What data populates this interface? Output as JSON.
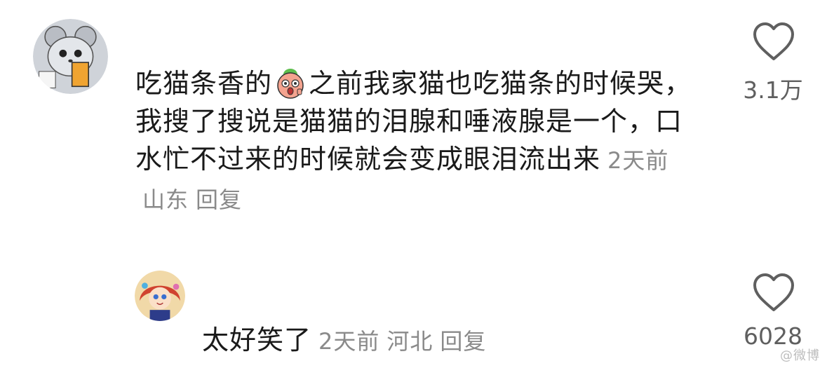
{
  "comments": [
    {
      "text_before_emoji": "吃猫条香的",
      "emoji": "peach-face-emoji",
      "text_after_emoji": "之前我家猫也吃猫条的时候哭，我搜了搜说是猫猫的泪腺和唾液腺是一个，口水忙不过来的时候就会变成眼泪流出来",
      "time": "2天前",
      "location": "山东",
      "reply_label": "回复",
      "likes": "3.1万"
    },
    {
      "text": "太好笑了",
      "time": "2天前",
      "location": "河北",
      "reply_label": "回复",
      "likes": "6028"
    }
  ],
  "watermark": "@微博",
  "colors": {
    "text": "#1a1a1a",
    "meta": "#8a8a8a",
    "icon": "#5f5f5f",
    "background": "#ffffff"
  }
}
